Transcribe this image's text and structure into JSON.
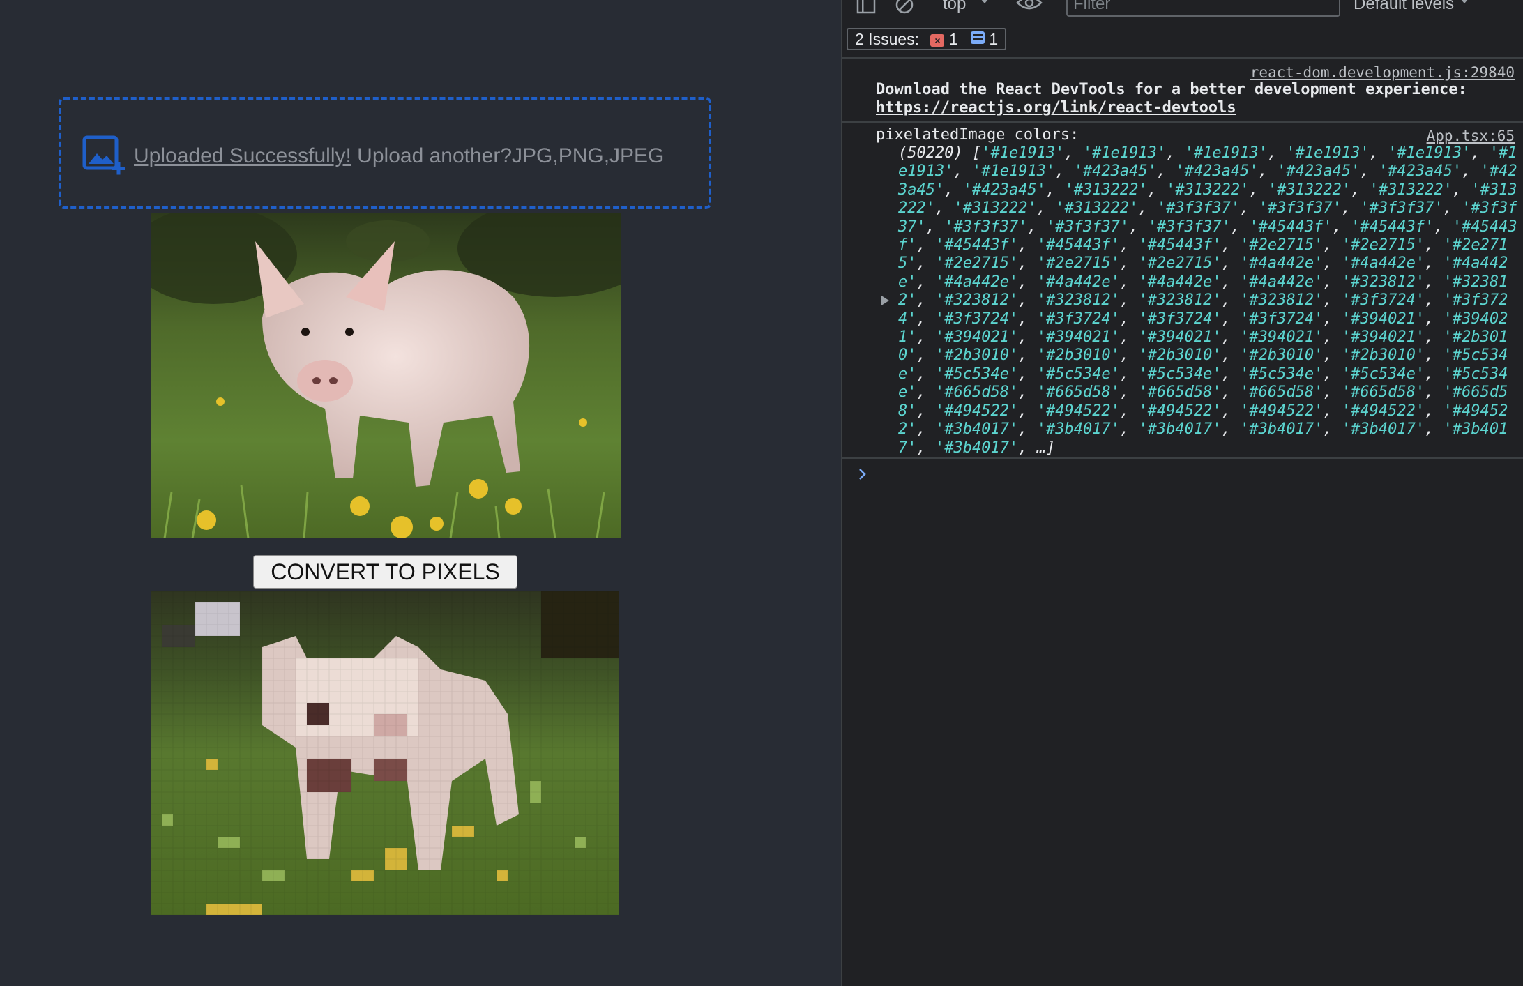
{
  "app": {
    "upload": {
      "success_text": "Uploaded Successfully!",
      "again_text": " Upload another?JPG,PNG,JPEG",
      "icon": "add-photo-icon"
    },
    "convert_label": "CONVERT TO PIXELS"
  },
  "devtools": {
    "toolbar": {
      "context": "top",
      "filter_placeholder": "Filter",
      "levels": "Default levels"
    },
    "issues": {
      "label": "2 Issues:",
      "errors": "1",
      "info": "1"
    },
    "messages": {
      "react": {
        "source": "react-dom.development.js:29840",
        "text": "Download the React DevTools for a better development experience: ",
        "link": "https://reactjs.org/link/react-devtools"
      },
      "pixel": {
        "source": "App.tsx:65",
        "label": "pixelatedImage colors:",
        "count": "(50220)",
        "colors": [
          "#1e1913",
          "#1e1913",
          "#1e1913",
          "#1e1913",
          "#1e1913",
          "#1e1913",
          "#1e1913",
          "#423a45",
          "#423a45",
          "#423a45",
          "#423a45",
          "#423a45",
          "#423a45",
          "#313222",
          "#313222",
          "#313222",
          "#313222",
          "#313222",
          "#313222",
          "#313222",
          "#3f3f37",
          "#3f3f37",
          "#3f3f37",
          "#3f3f37",
          "#3f3f37",
          "#3f3f37",
          "#3f3f37",
          "#45443f",
          "#45443f",
          "#45443f",
          "#45443f",
          "#45443f",
          "#45443f",
          "#2e2715",
          "#2e2715",
          "#2e2715",
          "#2e2715",
          "#2e2715",
          "#2e2715",
          "#4a442e",
          "#4a442e",
          "#4a442e",
          "#4a442e",
          "#4a442e",
          "#4a442e",
          "#4a442e",
          "#323812",
          "#323812",
          "#323812",
          "#323812",
          "#323812",
          "#323812",
          "#3f3724",
          "#3f3724",
          "#3f3724",
          "#3f3724",
          "#3f3724",
          "#3f3724",
          "#394021",
          "#394021",
          "#394021",
          "#394021",
          "#394021",
          "#394021",
          "#394021",
          "#2b3010",
          "#2b3010",
          "#2b3010",
          "#2b3010",
          "#2b3010",
          "#2b3010",
          "#5c534e",
          "#5c534e",
          "#5c534e",
          "#5c534e",
          "#5c534e",
          "#5c534e",
          "#5c534e",
          "#665d58",
          "#665d58",
          "#665d58",
          "#665d58",
          "#665d58",
          "#665d58",
          "#494522",
          "#494522",
          "#494522",
          "#494522",
          "#494522",
          "#494522",
          "#3b4017",
          "#3b4017",
          "#3b4017",
          "#3b4017",
          "#3b4017",
          "#3b4017",
          "#3b4017"
        ],
        "ellipsis": "…"
      }
    }
  },
  "colors": {
    "page_bg": "#282c34",
    "upload_border": "#1f5fc9",
    "devtools_bg": "#202124",
    "string_color": "#5cd5d0"
  }
}
